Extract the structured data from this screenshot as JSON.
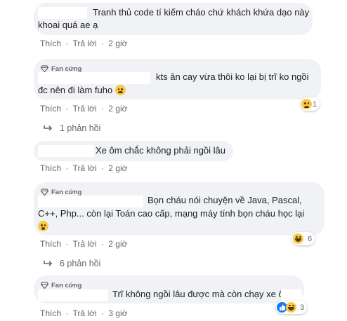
{
  "comments": [
    {
      "text_lines": [
        "Tranh thủ code tí kiếm cháo chứ khách khứa dạo này",
        "khoai quá ae ạ"
      ],
      "actions": {
        "like": "Thích",
        "reply": "Trả lời",
        "time": "2 giờ"
      }
    },
    {
      "badge": "Fan cứng",
      "text_lines": [
        "kts ăn cay vừa thôi ko lại bị trĩ ko ngồi",
        "đc nên đi làm fuho"
      ],
      "actions": {
        "like": "Thích",
        "reply": "Trả lời",
        "time": "2 giờ"
      },
      "reaction": {
        "icon": "sad-reaction-icon",
        "count": "1"
      },
      "replies_label": "1 phản hồi"
    },
    {
      "text_lines": [
        "Xe ôm chắc không phải ngồi lâu"
      ],
      "actions": {
        "like": "Thích",
        "reply": "Trả lời",
        "time": "2 giờ"
      }
    },
    {
      "badge": "Fan cứng",
      "text_lines": [
        "Bọn cháu nói chuyện về Java, Pascal,",
        "C++, Php... còn lại Toán cao cấp, mạng máy tính bọn cháu học lại"
      ],
      "actions": {
        "like": "Thích",
        "reply": "Trả lời",
        "time": "2 giờ"
      },
      "reaction": {
        "icon": "haha-reaction-icon",
        "count": "6"
      },
      "replies_label": "6 phản hồi"
    },
    {
      "badge": "Fan cứng",
      "text_lines": [
        "Trĩ không ngồi lâu được mà còn chạy xe ôm"
      ],
      "actions": {
        "like": "Thích",
        "reply": "Trả lời",
        "time": "3 giờ"
      },
      "reaction": {
        "icon": "like-haha-reaction-icon",
        "count": "3"
      }
    }
  ],
  "separator": "·",
  "colors": {
    "bubble": "#f0f2f5",
    "meta": "#65676b",
    "text": "#1c1e21",
    "like_blue": "#1877f2",
    "emoji_yellow": "#f7c948"
  }
}
